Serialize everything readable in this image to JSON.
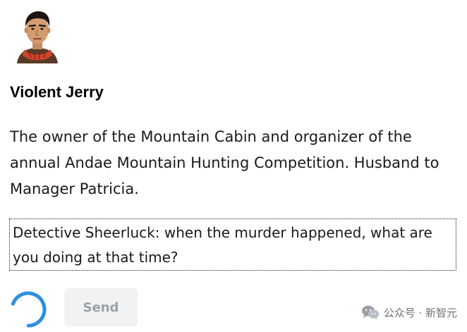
{
  "character": {
    "name": "Violent Jerry",
    "description": "The owner of the Mountain Cabin and organizer of the annual Andae Mountain Hunting Competition. Husband to Manager Patricia."
  },
  "chat": {
    "question": "Detective Sheerluck: when the murder happened, what are you doing at that time?",
    "send_label": "Send",
    "loading": true
  },
  "watermark": {
    "text": "公众号 · 新智元",
    "icon": "wechat-icon"
  },
  "colors": {
    "spinner": "#2e8fe0",
    "button_bg": "#f1f2f4",
    "button_text": "#9aa0a8"
  }
}
